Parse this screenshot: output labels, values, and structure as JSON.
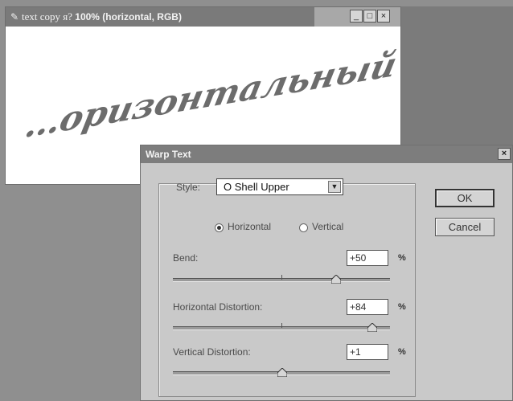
{
  "document": {
    "title_prefix": "text copy я? ",
    "title_bold": "100% (horizontal, RGB)",
    "warped_text": "…оризонтальный",
    "controls": {
      "minimize": "_",
      "maximize": "□",
      "close": "×"
    }
  },
  "dialog": {
    "title": "Warp Text",
    "close_glyph": "×",
    "style_label": "Style:",
    "style_value": "O  Shell Upper",
    "style_arrow": "▼",
    "orientation": {
      "horizontal_label": "Horizontal",
      "vertical_label": "Vertical",
      "selected": "horizontal"
    },
    "bend": {
      "label": "Bend:",
      "value": "+50",
      "unit": "%"
    },
    "horizontal_distortion": {
      "label": "Horizontal Distortion:",
      "value": "+84",
      "unit": "%"
    },
    "vertical_distortion": {
      "label": "Vertical Distortion:",
      "value": "+1",
      "unit": "%"
    },
    "ok_label": "OK",
    "cancel_label": "Cancel"
  },
  "sliders": {
    "bend": 50,
    "horizontal_distortion": 84,
    "vertical_distortion": 1,
    "min": -100,
    "max": 100
  }
}
